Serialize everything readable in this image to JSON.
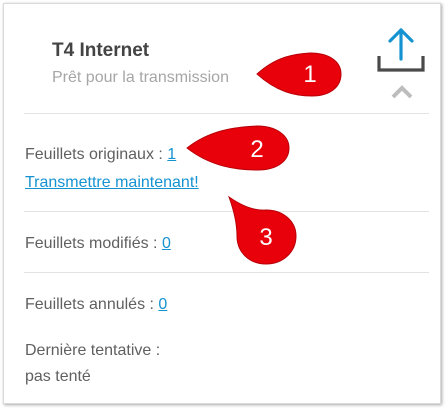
{
  "header": {
    "title": "T4 Internet",
    "subtitle": "Prêt pour la transmission",
    "upload_icon": "upload-icon",
    "collapse_icon": "chevron-up-icon"
  },
  "sections": {
    "original": {
      "label": "Feuillets originaux : ",
      "count": "1"
    },
    "transmit_link": "Transmettre maintenant!",
    "modified": {
      "label": "Feuillets modifiés : ",
      "count": "0"
    },
    "cancelled": {
      "label": "Feuillets annulés : ",
      "count": "0"
    },
    "last_attempt": {
      "label": "Dernière tentative :",
      "value": "pas tenté"
    }
  },
  "callouts": [
    "1",
    "2",
    "3"
  ],
  "colors": {
    "accent": "#1593d1",
    "callout": "#e8000b",
    "title": "#444444",
    "subtitle": "#a6a6a6",
    "text": "#606060"
  }
}
